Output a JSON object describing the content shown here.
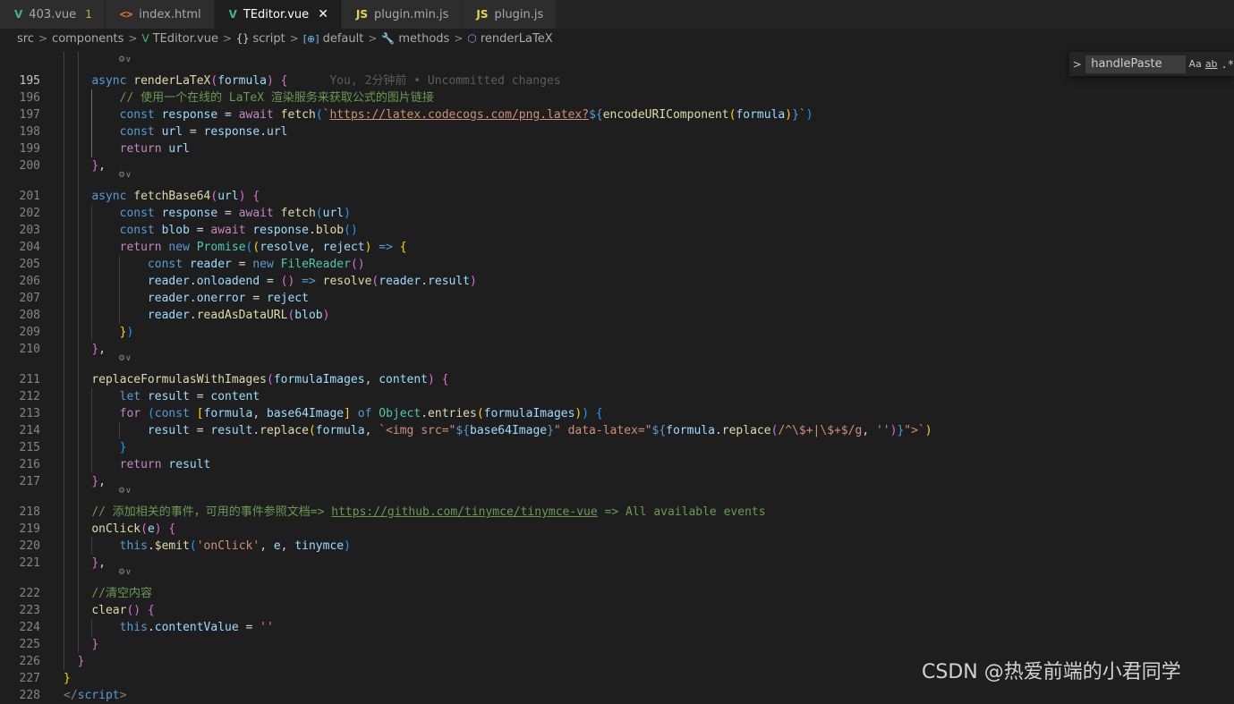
{
  "tabs": [
    {
      "label": "403.vue",
      "icon": "vue-icon",
      "modified": "1",
      "active": false
    },
    {
      "label": "index.html",
      "icon": "html-icon",
      "active": false
    },
    {
      "label": "TEditor.vue",
      "icon": "vue-icon",
      "active": true
    },
    {
      "label": "plugin.min.js",
      "icon": "js-icon",
      "active": false
    },
    {
      "label": "plugin.js",
      "icon": "js-icon",
      "active": false
    }
  ],
  "breadcrumb": [
    {
      "label": "src",
      "icon": ""
    },
    {
      "label": "components",
      "icon": ""
    },
    {
      "label": "TEditor.vue",
      "icon": "vue-icon"
    },
    {
      "label": "script",
      "icon": "braces-icon"
    },
    {
      "label": "default",
      "icon": "variable-icon"
    },
    {
      "label": "methods",
      "icon": "wrench-icon"
    },
    {
      "label": "renderLaTeX",
      "icon": "cube-icon"
    }
  ],
  "icons": {
    "vue": "V",
    "html": "<>",
    "js": "JS",
    "close": "✕",
    "chevron": ">",
    "braces": "{}",
    "variable": "[⊕]",
    "wrench": "🔧",
    "cube": "⬡",
    "fold": "⚙∨"
  },
  "find_widget": {
    "value": "handlePaste",
    "toggle_icon": "chevron-right-icon",
    "match_case": "Aa",
    "whole_word": "ab",
    "regex": ".*"
  },
  "git_blame": "You, 2分钟前 • Uncommitted changes",
  "watermark": "CSDN @热爱前端的小君同学",
  "code_lines": [
    {
      "n": "195",
      "fold": true,
      "cur": true,
      "t": [
        [
          "    ",
          "p"
        ],
        [
          "async ",
          "k"
        ],
        [
          "renderLaTeX",
          "f"
        ],
        [
          "(",
          "b2"
        ],
        [
          "formula",
          "v"
        ],
        [
          ") ",
          "b2"
        ],
        [
          "{",
          "b2"
        ]
      ],
      "blame": true
    },
    {
      "n": "196",
      "t": [
        [
          "        ",
          "p"
        ],
        [
          "// 使用一个在线的 LaTeX 渲染服务来获取公式的图片链接",
          "cm"
        ]
      ]
    },
    {
      "n": "197",
      "t": [
        [
          "        ",
          "p"
        ],
        [
          "const ",
          "k"
        ],
        [
          "response",
          "v"
        ],
        [
          " = ",
          "p"
        ],
        [
          "await ",
          "c"
        ],
        [
          "fetch",
          "f"
        ],
        [
          "(",
          "b3"
        ],
        [
          "`",
          "s"
        ],
        [
          "https://latex.codecogs.com/png.latex?",
          "u"
        ],
        [
          "${",
          "k"
        ],
        [
          "encodeURIComponent",
          "f"
        ],
        [
          "(",
          "b1"
        ],
        [
          "formula",
          "v"
        ],
        [
          ")",
          "b1"
        ],
        [
          "}",
          "k"
        ],
        [
          "`",
          "s"
        ],
        [
          ")",
          "b3"
        ]
      ]
    },
    {
      "n": "198",
      "t": [
        [
          "        ",
          "p"
        ],
        [
          "const ",
          "k"
        ],
        [
          "url",
          "v"
        ],
        [
          " = ",
          "p"
        ],
        [
          "response",
          "v"
        ],
        [
          ".",
          "p"
        ],
        [
          "url",
          "v"
        ]
      ]
    },
    {
      "n": "199",
      "t": [
        [
          "        ",
          "p"
        ],
        [
          "return ",
          "c"
        ],
        [
          "url",
          "v"
        ]
      ]
    },
    {
      "n": "200",
      "t": [
        [
          "    ",
          "p"
        ],
        [
          "}",
          "b2"
        ],
        [
          ",",
          "p"
        ]
      ]
    },
    {
      "n": "201",
      "fold": true,
      "t": [
        [
          "    ",
          "p"
        ],
        [
          "async ",
          "k"
        ],
        [
          "fetchBase64",
          "f"
        ],
        [
          "(",
          "b2"
        ],
        [
          "url",
          "v"
        ],
        [
          ") ",
          "b2"
        ],
        [
          "{",
          "b2"
        ]
      ]
    },
    {
      "n": "202",
      "t": [
        [
          "        ",
          "p"
        ],
        [
          "const ",
          "k"
        ],
        [
          "response",
          "v"
        ],
        [
          " = ",
          "p"
        ],
        [
          "await ",
          "c"
        ],
        [
          "fetch",
          "f"
        ],
        [
          "(",
          "b3"
        ],
        [
          "url",
          "v"
        ],
        [
          ")",
          "b3"
        ]
      ]
    },
    {
      "n": "203",
      "t": [
        [
          "        ",
          "p"
        ],
        [
          "const ",
          "k"
        ],
        [
          "blob",
          "v"
        ],
        [
          " = ",
          "p"
        ],
        [
          "await ",
          "c"
        ],
        [
          "response",
          "v"
        ],
        [
          ".",
          "p"
        ],
        [
          "blob",
          "f"
        ],
        [
          "()",
          "b3"
        ]
      ]
    },
    {
      "n": "204",
      "t": [
        [
          "        ",
          "p"
        ],
        [
          "return ",
          "c"
        ],
        [
          "new ",
          "k"
        ],
        [
          "Promise",
          "t"
        ],
        [
          "(",
          "b3"
        ],
        [
          "(",
          "b1"
        ],
        [
          "resolve",
          "v"
        ],
        [
          ", ",
          "p"
        ],
        [
          "reject",
          "v"
        ],
        [
          ") ",
          "b1"
        ],
        [
          "=> ",
          "k"
        ],
        [
          "{",
          "b1"
        ]
      ]
    },
    {
      "n": "205",
      "t": [
        [
          "            ",
          "p"
        ],
        [
          "const ",
          "k"
        ],
        [
          "reader",
          "v"
        ],
        [
          " = ",
          "p"
        ],
        [
          "new ",
          "k"
        ],
        [
          "FileReader",
          "t"
        ],
        [
          "()",
          "b2"
        ]
      ]
    },
    {
      "n": "206",
      "t": [
        [
          "            ",
          "p"
        ],
        [
          "reader",
          "v"
        ],
        [
          ".",
          "p"
        ],
        [
          "onloadend",
          "v"
        ],
        [
          " = ",
          "p"
        ],
        [
          "() ",
          "b2"
        ],
        [
          "=> ",
          "k"
        ],
        [
          "resolve",
          "f"
        ],
        [
          "(",
          "b2"
        ],
        [
          "reader",
          "v"
        ],
        [
          ".",
          "p"
        ],
        [
          "result",
          "v"
        ],
        [
          ")",
          "b2"
        ]
      ]
    },
    {
      "n": "207",
      "t": [
        [
          "            ",
          "p"
        ],
        [
          "reader",
          "v"
        ],
        [
          ".",
          "p"
        ],
        [
          "onerror",
          "v"
        ],
        [
          " = ",
          "p"
        ],
        [
          "reject",
          "v"
        ]
      ]
    },
    {
      "n": "208",
      "t": [
        [
          "            ",
          "p"
        ],
        [
          "reader",
          "v"
        ],
        [
          ".",
          "p"
        ],
        [
          "readAsDataURL",
          "f"
        ],
        [
          "(",
          "b2"
        ],
        [
          "blob",
          "v"
        ],
        [
          ")",
          "b2"
        ]
      ]
    },
    {
      "n": "209",
      "t": [
        [
          "        ",
          "p"
        ],
        [
          "}",
          "b1"
        ],
        [
          ")",
          "b3"
        ]
      ]
    },
    {
      "n": "210",
      "t": [
        [
          "    ",
          "p"
        ],
        [
          "}",
          "b2"
        ],
        [
          ",",
          "p"
        ]
      ]
    },
    {
      "n": "211",
      "fold": true,
      "t": [
        [
          "    ",
          "p"
        ],
        [
          "replaceFormulasWithImages",
          "f"
        ],
        [
          "(",
          "b2"
        ],
        [
          "formulaImages",
          "v"
        ],
        [
          ", ",
          "p"
        ],
        [
          "content",
          "v"
        ],
        [
          ") ",
          "b2"
        ],
        [
          "{",
          "b2"
        ]
      ]
    },
    {
      "n": "212",
      "t": [
        [
          "        ",
          "p"
        ],
        [
          "let ",
          "k"
        ],
        [
          "result",
          "v"
        ],
        [
          " = ",
          "p"
        ],
        [
          "content",
          "v"
        ]
      ]
    },
    {
      "n": "213",
      "t": [
        [
          "        ",
          "p"
        ],
        [
          "for ",
          "c"
        ],
        [
          "(",
          "b3"
        ],
        [
          "const ",
          "k"
        ],
        [
          "[",
          "b1"
        ],
        [
          "formula",
          "v"
        ],
        [
          ", ",
          "p"
        ],
        [
          "base64Image",
          "v"
        ],
        [
          "] ",
          "b1"
        ],
        [
          "of ",
          "k"
        ],
        [
          "Object",
          "t"
        ],
        [
          ".",
          "p"
        ],
        [
          "entries",
          "f"
        ],
        [
          "(",
          "b1"
        ],
        [
          "formulaImages",
          "v"
        ],
        [
          ")",
          "b1"
        ],
        [
          ") ",
          "b3"
        ],
        [
          "{",
          "b3"
        ]
      ]
    },
    {
      "n": "214",
      "t": [
        [
          "            ",
          "p"
        ],
        [
          "result",
          "v"
        ],
        [
          " = ",
          "p"
        ],
        [
          "result",
          "v"
        ],
        [
          ".",
          "p"
        ],
        [
          "replace",
          "f"
        ],
        [
          "(",
          "b1"
        ],
        [
          "formula",
          "v"
        ],
        [
          ", ",
          "p"
        ],
        [
          "`<img src=\"",
          "s"
        ],
        [
          "${",
          "k"
        ],
        [
          "base64Image",
          "v"
        ],
        [
          "}",
          "k"
        ],
        [
          "\" data-latex=\"",
          "s"
        ],
        [
          "${",
          "k"
        ],
        [
          "formula",
          "v"
        ],
        [
          ".",
          "p"
        ],
        [
          "replace",
          "f"
        ],
        [
          "(",
          "b2"
        ],
        [
          "/^\\$+|\\$+$/g",
          "s"
        ],
        [
          ", ",
          "p"
        ],
        [
          "''",
          "s"
        ],
        [
          ")",
          "b2"
        ],
        [
          "}",
          "k"
        ],
        [
          "\">`",
          "s"
        ],
        [
          ")",
          "b1"
        ]
      ]
    },
    {
      "n": "215",
      "t": [
        [
          "        ",
          "p"
        ],
        [
          "}",
          "b3"
        ]
      ]
    },
    {
      "n": "216",
      "t": [
        [
          "        ",
          "p"
        ],
        [
          "return ",
          "c"
        ],
        [
          "result",
          "v"
        ]
      ]
    },
    {
      "n": "217",
      "t": [
        [
          "    ",
          "p"
        ],
        [
          "}",
          "b2"
        ],
        [
          ",",
          "p"
        ]
      ]
    },
    {
      "n": "218",
      "fold": true,
      "t": [
        [
          "    ",
          "p"
        ],
        [
          "// 添加相关的事件，可用的事件参照文档=> ",
          "cm"
        ],
        [
          "https://github.com/tinymce/tinymce-vue",
          "ucm"
        ],
        [
          " => All available events",
          "cm"
        ]
      ]
    },
    {
      "n": "219",
      "t": [
        [
          "    ",
          "p"
        ],
        [
          "onClick",
          "f"
        ],
        [
          "(",
          "b2"
        ],
        [
          "e",
          "v"
        ],
        [
          ") ",
          "b2"
        ],
        [
          "{",
          "b2"
        ]
      ]
    },
    {
      "n": "220",
      "t": [
        [
          "        ",
          "p"
        ],
        [
          "this",
          "k"
        ],
        [
          ".",
          "p"
        ],
        [
          "$emit",
          "f"
        ],
        [
          "(",
          "b3"
        ],
        [
          "'onClick'",
          "s"
        ],
        [
          ", ",
          "p"
        ],
        [
          "e",
          "v"
        ],
        [
          ", ",
          "p"
        ],
        [
          "tinymce",
          "v"
        ],
        [
          ")",
          "b3"
        ]
      ]
    },
    {
      "n": "221",
      "t": [
        [
          "    ",
          "p"
        ],
        [
          "}",
          "b2"
        ],
        [
          ",",
          "p"
        ]
      ]
    },
    {
      "n": "222",
      "fold": true,
      "t": [
        [
          "    ",
          "p"
        ],
        [
          "//清空内容",
          "cm"
        ]
      ]
    },
    {
      "n": "223",
      "t": [
        [
          "    ",
          "p"
        ],
        [
          "clear",
          "f"
        ],
        [
          "() ",
          "b2"
        ],
        [
          "{",
          "b2"
        ]
      ]
    },
    {
      "n": "224",
      "t": [
        [
          "        ",
          "p"
        ],
        [
          "this",
          "k"
        ],
        [
          ".",
          "p"
        ],
        [
          "contentValue",
          "v"
        ],
        [
          " = ",
          "p"
        ],
        [
          "''",
          "s"
        ]
      ]
    },
    {
      "n": "225",
      "t": [
        [
          "    ",
          "p"
        ],
        [
          "}",
          "b2"
        ]
      ]
    },
    {
      "n": "226",
      "t": [
        [
          "  ",
          "p"
        ],
        [
          "}",
          "b2"
        ]
      ]
    },
    {
      "n": "227",
      "t": [
        [
          "}",
          "b1"
        ]
      ]
    },
    {
      "n": "228",
      "t": [
        [
          "</",
          "tg"
        ],
        [
          "script",
          "k"
        ],
        [
          ">",
          "tg"
        ]
      ]
    }
  ]
}
